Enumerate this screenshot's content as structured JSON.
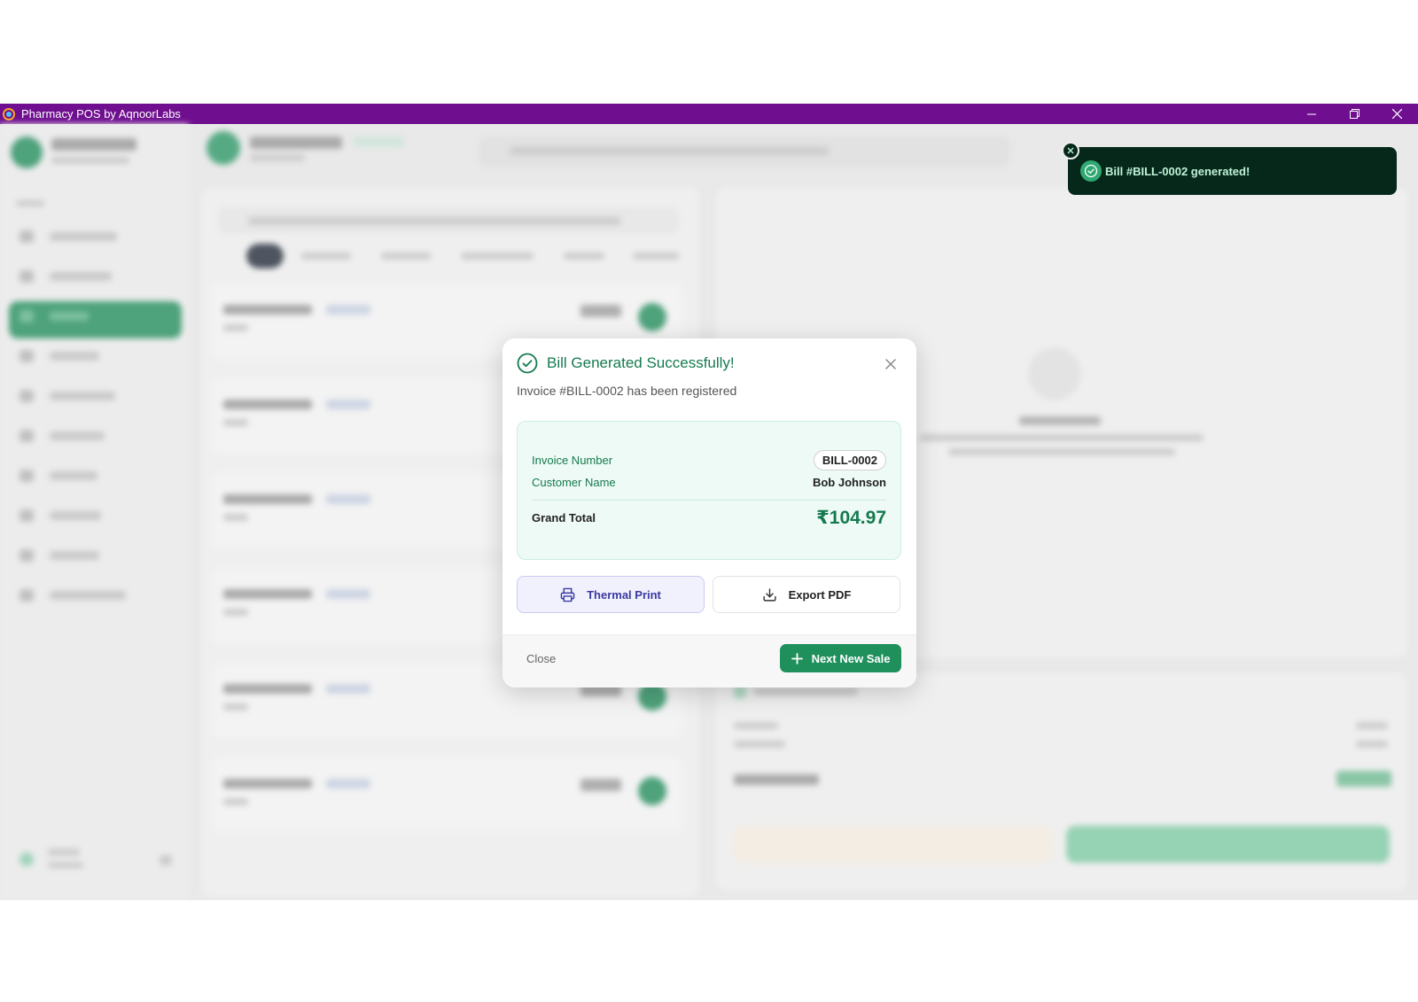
{
  "window": {
    "title": "Pharmacy POS by AqnoorLabs",
    "controls": [
      "minimize",
      "restore",
      "close"
    ]
  },
  "modal": {
    "title": "Bill Generated Successfully!",
    "subtitle": "Invoice #BILL-0002 has been registered",
    "invoice_number_label": "Invoice Number",
    "invoice_number": "BILL-0002",
    "customer_name_label": "Customer Name",
    "customer_name": "Bob Johnson",
    "grand_total_label": "Grand Total",
    "grand_total": "₹104.97",
    "thermal_print_label": "Thermal Print",
    "export_pdf_label": "Export PDF",
    "close_label": "Close",
    "next_sale_label": "Next New Sale"
  },
  "toast": {
    "message": "Bill #BILL-0002 generated!"
  },
  "colors": {
    "titlebar": "#6f0f8f",
    "brand_green": "#1f8f5c",
    "toast_bg": "#06281a"
  }
}
